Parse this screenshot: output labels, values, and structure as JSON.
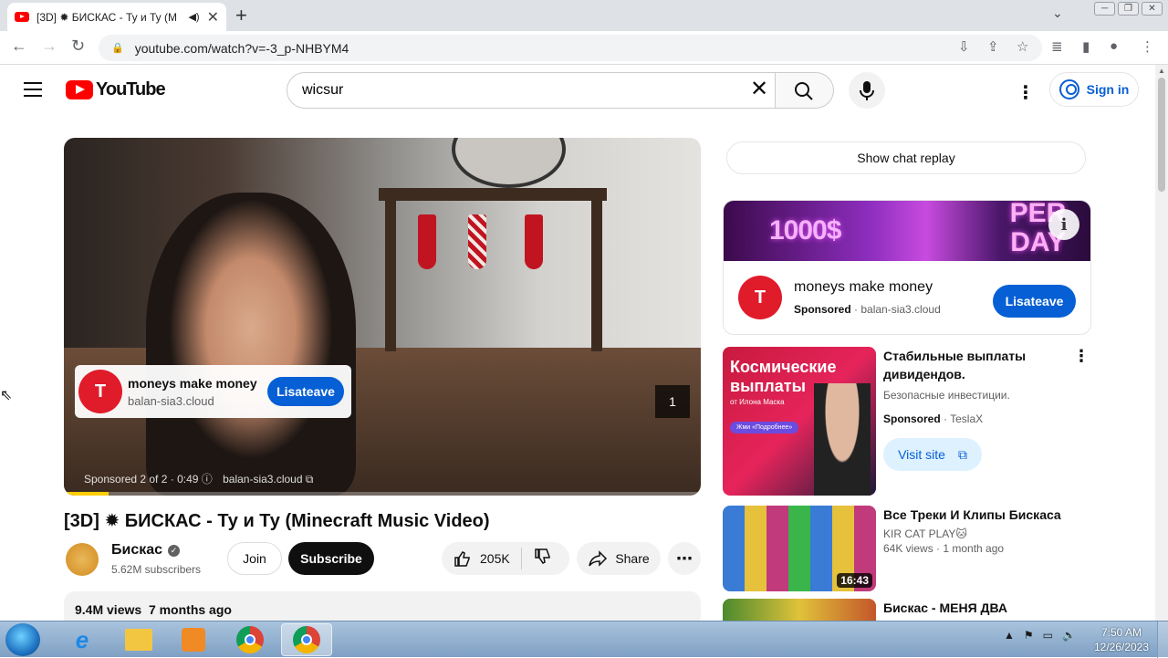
{
  "browser": {
    "tab_title": "[3D] ✹ БИСКАС - Ту и Ту (M",
    "url": "youtube.com/watch?v=-3_p-NHBYM4"
  },
  "yt": {
    "logo_text": "YouTube",
    "search_value": "wicsur",
    "signin": "Sign in"
  },
  "player": {
    "ad": {
      "title": "moneys make money",
      "domain": "balan-sia3.cloud",
      "button": "Lisateave"
    },
    "skip_counter": "1",
    "ad_info": "Sponsored 2 of 2 · 0:49",
    "ad_info_domain": "balan-sia3.cloud",
    "ad_progress": 0.07
  },
  "video": {
    "title": "[3D] ✹ БИСКАС - Ту и Ту (Minecraft Music Video)",
    "channel": "Бискас",
    "subscribers": "5.62M subscribers",
    "join": "Join",
    "subscribe": "Subscribe",
    "likes": "205K",
    "share": "Share",
    "views": "9.4M views",
    "age": "7 months ago"
  },
  "sidebar": {
    "chat_replay": "Show chat replay",
    "ad": {
      "banner_left": "1000$",
      "banner_right": "PER DAY",
      "title": "moneys make money",
      "sponsored": "Sponsored",
      "domain": "balan-sia3.cloud",
      "button": "Lisateave"
    },
    "ad2": {
      "thumb_line1": "Космические",
      "thumb_line2": "выплаты",
      "thumb_sub": "от Илона Маска",
      "thumb_pill": "Жми «Подробнее»",
      "title": "Стабильные выплаты дивидендов.",
      "desc": "Безопасные инвестиции.",
      "sponsored": "Sponsored",
      "advertiser": "TeslaX",
      "button": "Visit site"
    },
    "videos": [
      {
        "title": "Все Треки И Клипы Бискаса",
        "channel": "KIR CAT PLAY🐱",
        "meta": "64K views · 1 month ago",
        "duration": "16:43"
      },
      {
        "title": "Бискас - МЕНЯ ДВА",
        "channel": "",
        "meta": "",
        "duration": ""
      }
    ]
  },
  "taskbar": {
    "time": "7:50 AM",
    "date": "12/26/2023"
  }
}
